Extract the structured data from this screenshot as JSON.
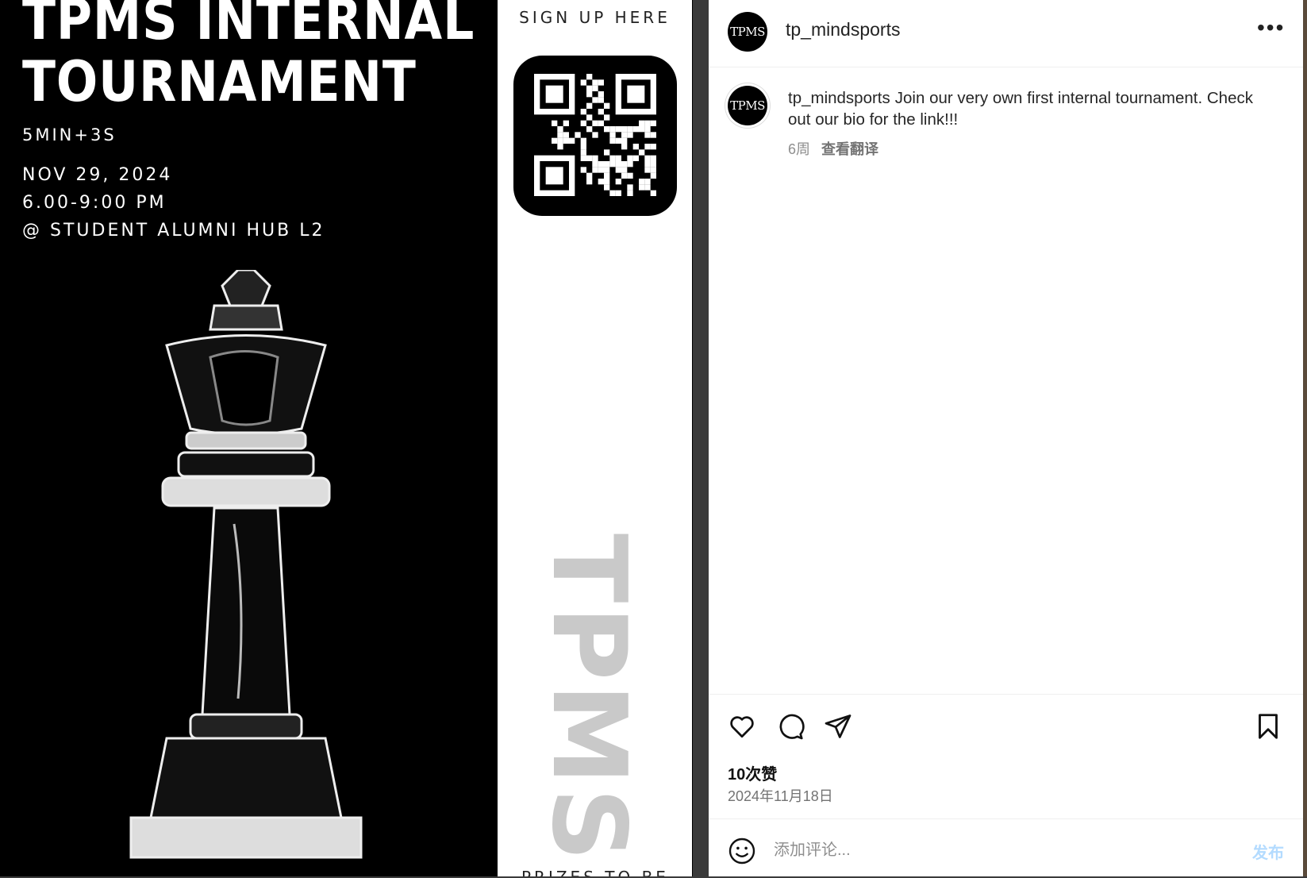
{
  "poster": {
    "title_line1": "TPMS INTERNAL",
    "title_line2": "TOURNAMENT",
    "format": "5MIN+3S",
    "date": "NOV 29, 2024",
    "time": "6.00-9:00 PM",
    "venue": "@ STUDENT ALUMNI HUB L2",
    "signup": "SIGN UP HERE",
    "logo": "TPMS",
    "prizes": "PRIZES TO BE"
  },
  "post": {
    "username": "tp_mindsports",
    "avatar_text": "TPMS",
    "caption_user": "tp_mindsports",
    "caption_text": "Join our very own first internal tournament. Check out our bio for the link!!!",
    "age": "6周",
    "translate_label": "查看翻译",
    "likes": "10次赞",
    "date": "2024年11月18日",
    "comment_placeholder": "添加评论...",
    "post_label": "发布"
  },
  "icons": {
    "more": "more-options-icon",
    "like": "heart-icon",
    "comment": "comment-icon",
    "share": "send-icon",
    "save": "bookmark-icon",
    "emoji": "emoji-icon"
  },
  "colors": {
    "poster_bg": "#000000",
    "post_button": "#b3dbff",
    "muted_text": "#737373"
  }
}
